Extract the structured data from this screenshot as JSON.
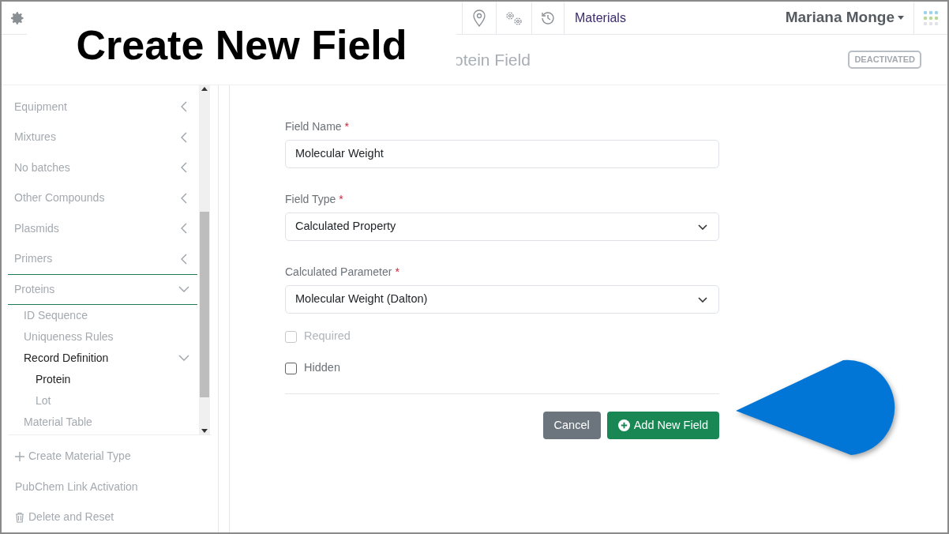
{
  "overlay_title": "Create New Field",
  "top_bar": {
    "section": "Materials",
    "user": "Mariana Monge"
  },
  "page_header": {
    "title": "otein Field",
    "status_badge": "DEACTIVATED"
  },
  "sidebar": {
    "items": [
      {
        "label": "Equipment",
        "expanded": false,
        "selected": false
      },
      {
        "label": "Mixtures",
        "expanded": false,
        "selected": false
      },
      {
        "label": "No batches",
        "expanded": false,
        "selected": false
      },
      {
        "label": "Other Compounds",
        "expanded": false,
        "selected": false
      },
      {
        "label": "Plasmids",
        "expanded": false,
        "selected": false
      },
      {
        "label": "Primers",
        "expanded": false,
        "selected": false
      },
      {
        "label": "Proteins",
        "expanded": true,
        "selected": false,
        "children": [
          {
            "label": "ID Sequence",
            "selected": false
          },
          {
            "label": "Uniqueness Rules",
            "selected": false
          },
          {
            "label": "Record Definition",
            "expanded": true,
            "selected": true,
            "children": [
              {
                "label": "Protein",
                "selected": true
              },
              {
                "label": "Lot",
                "selected": false
              }
            ]
          },
          {
            "label": "Material Table",
            "selected": false
          }
        ]
      }
    ],
    "footer": [
      {
        "kind": "add",
        "label": "Create Material Type"
      },
      {
        "kind": "plain",
        "label": "PubChem Link Activation"
      },
      {
        "kind": "delete",
        "label": "Delete and Reset"
      }
    ]
  },
  "form": {
    "fields": [
      {
        "kind": "text",
        "label": "Field Name",
        "required_mark": "*",
        "value": "Molecular Weight"
      },
      {
        "kind": "select",
        "label": "Field Type",
        "required_mark": "*",
        "value": "Calculated Property"
      },
      {
        "kind": "select",
        "label": "Calculated Parameter",
        "required_mark": "*",
        "value": "Molecular Weight (Dalton)"
      }
    ],
    "checkboxes": [
      {
        "label": "Required",
        "checked": false,
        "disabled": true
      },
      {
        "label": "Hidden",
        "checked": false,
        "disabled": false
      }
    ],
    "buttons": [
      {
        "kind": "secondary",
        "label": "Cancel"
      },
      {
        "kind": "primary",
        "label": "Add New Field"
      }
    ]
  }
}
